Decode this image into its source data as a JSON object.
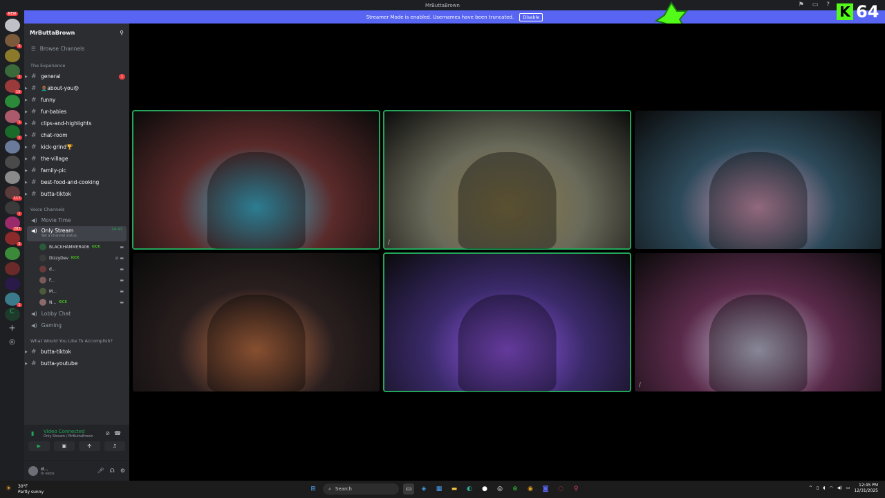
{
  "window": {
    "title": "MrButtaBrown"
  },
  "banner": {
    "text": "Streamer Mode is enabled. Usernames have been truncated.",
    "button": "Disable"
  },
  "overlay": {
    "kick_letter": "K",
    "kick_count": "64"
  },
  "servers": {
    "new_label": "NEW",
    "badges": [
      "5",
      "1",
      "10",
      "1",
      "1",
      "117",
      "1",
      "283",
      "3",
      "1"
    ]
  },
  "sidebar": {
    "guild_name": "MrButtaBrown",
    "browse": "Browse Channels",
    "categories": {
      "experience": "The Experience",
      "voice": "Voice Channels",
      "accomplish": "What Would You Like To Accomplish?"
    },
    "text_channels": [
      {
        "name": "general",
        "unread": "1"
      },
      {
        "name": "👨🏾‍🦲about-you😡"
      },
      {
        "name": "funny"
      },
      {
        "name": "fur-babies"
      },
      {
        "name": "clips-and-highlights"
      },
      {
        "name": "chat-room"
      },
      {
        "name": "kick-grind🏆"
      },
      {
        "name": "the-village"
      },
      {
        "name": "family-pic"
      },
      {
        "name": "best-food-and-cooking"
      },
      {
        "name": "butta-tiktok"
      }
    ],
    "voice_channels": {
      "movie": "Movie Time",
      "active": {
        "name": "Only Stream",
        "timer": "34:43",
        "status": "Set a channel status"
      },
      "members": [
        {
          "name": "BLACKHAMMER406",
          "tag": "KICK"
        },
        {
          "name": "DizzyDev",
          "tag": "KICK"
        },
        {
          "name": "d...",
          "tag": ""
        },
        {
          "name": "F...",
          "tag": ""
        },
        {
          "name": "M...",
          "tag": ""
        },
        {
          "name": "N...",
          "tag": "KICK"
        }
      ],
      "lobby": "Lobby Chat",
      "gaming": "Gaming"
    },
    "bottom_channels": [
      "butta-tiktok",
      "butta-youtube"
    ]
  },
  "voice_panel": {
    "title": "Video Connected",
    "sub": "Only Stream / MrButtaBrown"
  },
  "user_panel": {
    "name": "d...",
    "status": "In voice"
  },
  "tiles": [
    {
      "bg": "#5a2a2a",
      "accent": "#44c0e0",
      "speaking": true
    },
    {
      "bg": "#6a6a5a",
      "accent": "#8a7a4a",
      "speaking": true,
      "muted": true
    },
    {
      "bg": "#2d4a5a",
      "accent": "#e0a0c0",
      "speaking": false
    },
    {
      "bg": "#2a1f1f",
      "accent": "#d07a4a",
      "speaking": false
    },
    {
      "bg": "#3a2a6a",
      "accent": "#9a5af0",
      "speaking": true
    },
    {
      "bg": "#5a2a4a",
      "accent": "#d0d0e8",
      "speaking": false,
      "muted": true
    }
  ],
  "taskbar": {
    "weather_temp": "30°F",
    "weather_desc": "Partly sunny",
    "search": "Search",
    "time": "12:45 PM",
    "date": "12/31/2025"
  }
}
